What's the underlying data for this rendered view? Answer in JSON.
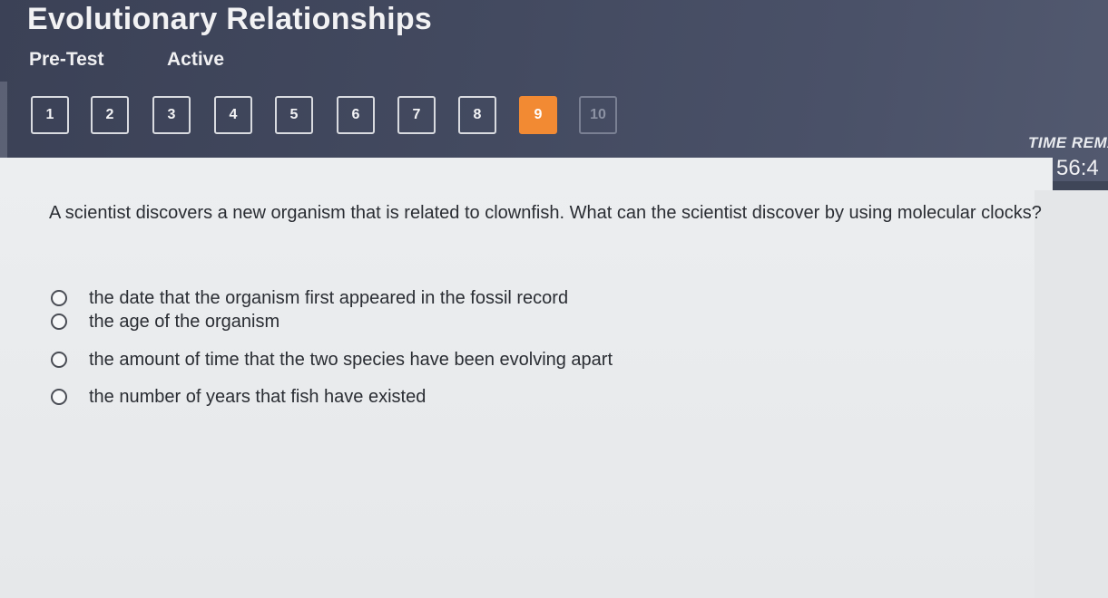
{
  "header": {
    "title": "Evolutionary Relationships",
    "test_type": "Pre-Test",
    "status": "Active"
  },
  "question_nav": [
    {
      "label": "1",
      "state": "answered"
    },
    {
      "label": "2",
      "state": "answered"
    },
    {
      "label": "3",
      "state": "answered"
    },
    {
      "label": "4",
      "state": "answered"
    },
    {
      "label": "5",
      "state": "answered"
    },
    {
      "label": "6",
      "state": "answered"
    },
    {
      "label": "7",
      "state": "answered"
    },
    {
      "label": "8",
      "state": "answered"
    },
    {
      "label": "9",
      "state": "current"
    },
    {
      "label": "10",
      "state": "unvisited"
    }
  ],
  "timer": {
    "label": "TIME REMA",
    "value": "56:4"
  },
  "question": {
    "text": "A scientist discovers a new organism that is related to clownfish. What can the scientist discover by using molecular clocks?",
    "options": [
      "the date that the organism first appeared in the fossil record",
      "the age of the organism",
      "the amount of time that the two species have been evolving apart",
      "the number of years that fish have existed"
    ]
  },
  "colors": {
    "header_bg": "#434a60",
    "current_question": "#f28a33",
    "content_bg": "#eceef0"
  }
}
